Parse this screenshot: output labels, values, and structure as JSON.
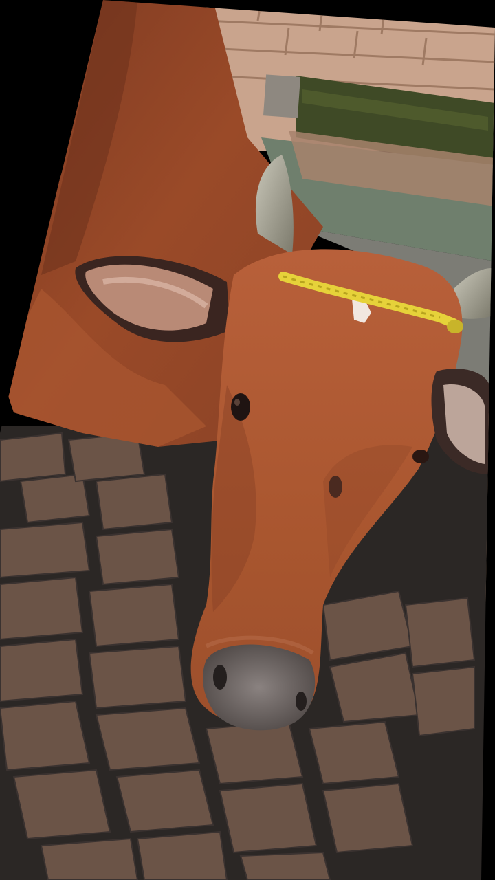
{
  "photo": {
    "subject": "cow-head",
    "palette": {
      "background": "#000000",
      "brick_wall": "#c9a48d",
      "moss": "#3f4a26",
      "water_trough": "#6f7f6d",
      "cow_body": "#9a4a28",
      "cow_face": "#b25c35",
      "horn": "#9c9a8c",
      "rope": "#e6d23a",
      "muzzle": "#6e6a68",
      "floor_brick": "#6b5447",
      "floor_grout": "#2b2725"
    }
  }
}
